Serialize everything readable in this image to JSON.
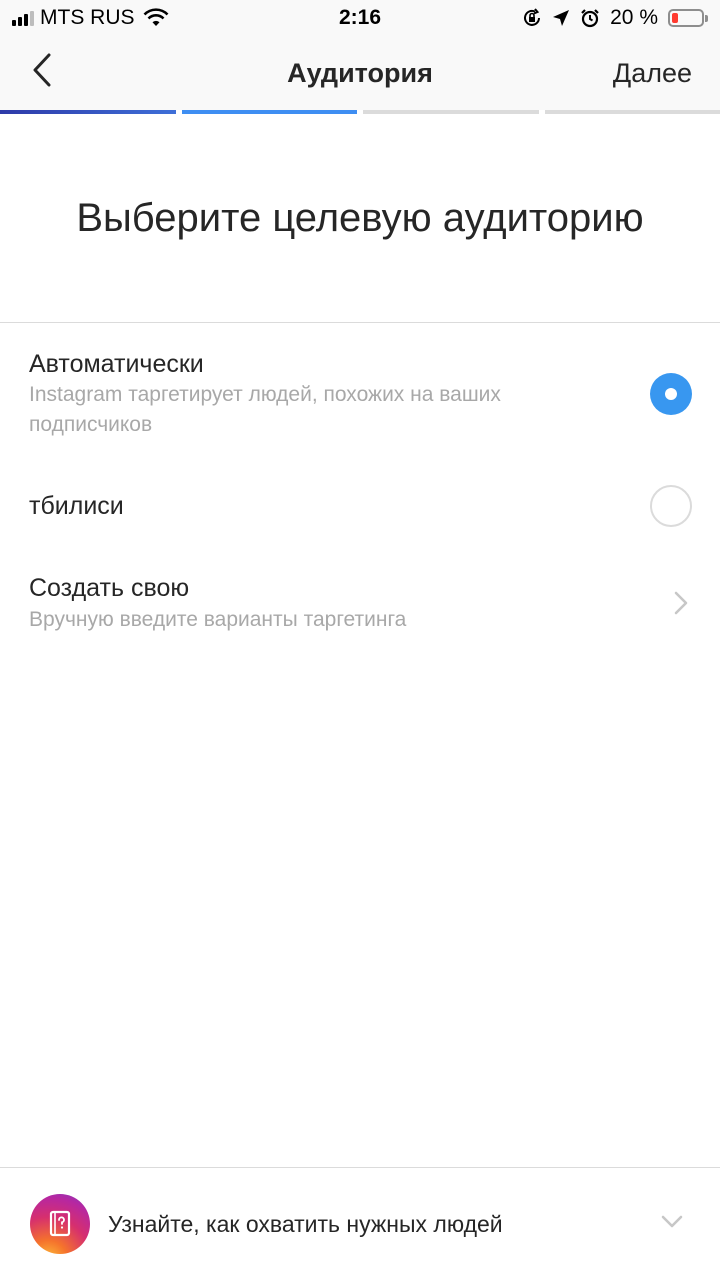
{
  "status_bar": {
    "carrier": "MTS RUS",
    "time": "2:16",
    "battery_percent": "20 %",
    "battery_level": 0.2
  },
  "nav": {
    "title": "Аудитория",
    "next_label": "Далее",
    "back_icon": "chevron-left-icon"
  },
  "progress": {
    "total_steps": 4,
    "completed_steps": 2
  },
  "heading": "Выберите целевую аудиторию",
  "options": [
    {
      "title": "Автоматически",
      "subtitle": "Instagram таргетирует людей, похожих на ваших подписчиков",
      "control": "radio",
      "selected": true
    },
    {
      "title": "тбилиси",
      "control": "radio",
      "selected": false
    },
    {
      "title": "Создать свою",
      "subtitle": "Вручную введите варианты таргетинга",
      "control": "chevron-right-icon"
    }
  ],
  "help": {
    "text": "Узнайте, как охватить нужных людей",
    "icon": "help-book-icon",
    "expand_icon": "chevron-down-icon"
  },
  "colors": {
    "accent": "#3897f0",
    "secondary_text": "#a8a8a8",
    "divider": "#dbdbdb",
    "battery_low": "#ff3b30"
  }
}
